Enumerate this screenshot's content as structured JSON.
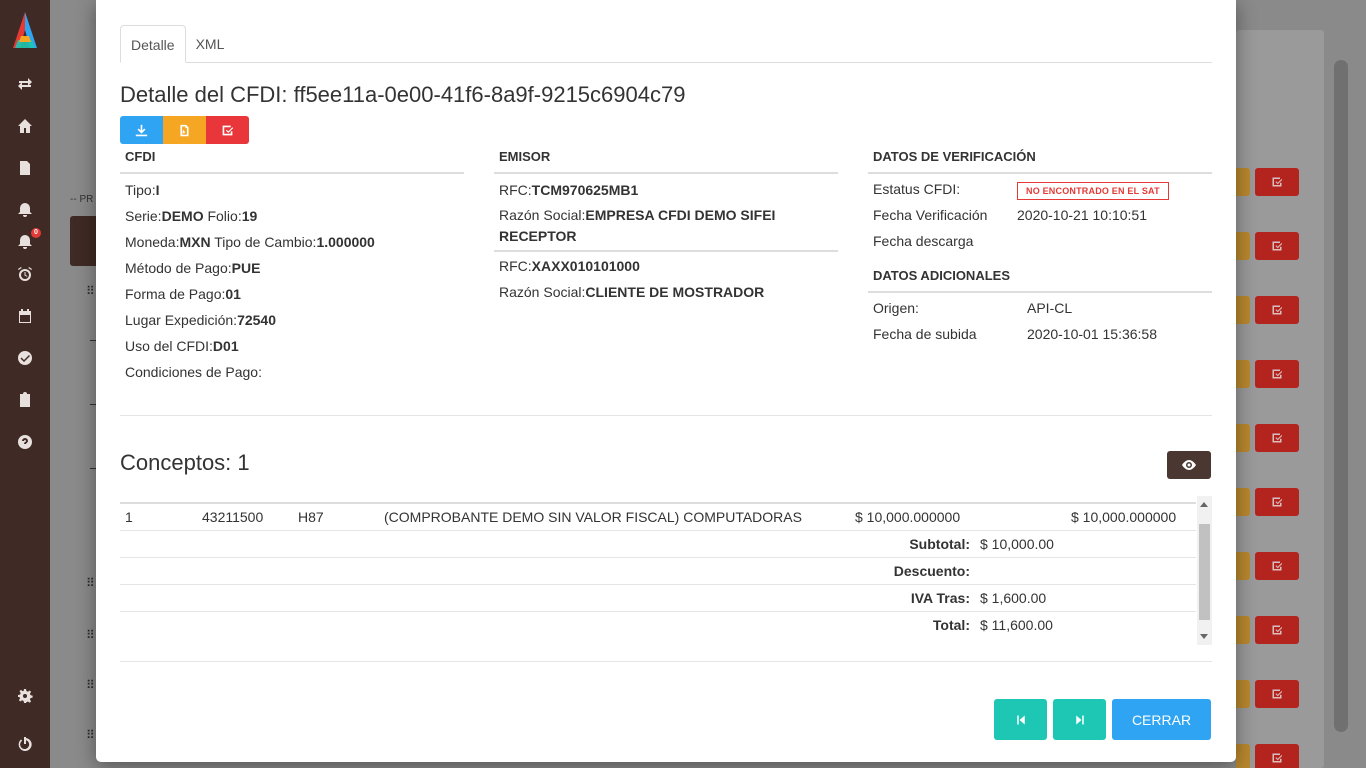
{
  "tabs": [
    {
      "label": "Detalle"
    },
    {
      "label": "XML"
    }
  ],
  "title": "Detalle del CFDI: ff5ee11a-0e00-41f6-8a9f-9215c6904c79",
  "background": {
    "prefix_label": "-- PR"
  },
  "sidebar": {
    "alarm_badge": "0"
  },
  "cfdi": {
    "heading": "CFDI",
    "tipo_label": "Tipo:",
    "tipo": "I",
    "serie_label": "Serie:",
    "serie": "DEMO",
    "folio_label": "Folio:",
    "folio": "19",
    "moneda_label": "Moneda:",
    "moneda": "MXN",
    "tipo_cambio_label": "Tipo de Cambio:",
    "tipo_cambio": "1.000000",
    "metodo_label": "Método de Pago:",
    "metodo": "PUE",
    "forma_label": "Forma de Pago:",
    "forma": "01",
    "lugar_label": "Lugar Expedición:",
    "lugar": "72540",
    "uso_label": "Uso del CFDI:",
    "uso": "D01",
    "condiciones_label": "Condiciones de Pago:"
  },
  "emisor": {
    "heading": "EMISOR",
    "rfc_label": "RFC:",
    "rfc": "TCM970625MB1",
    "razon_label": "Razón Social:",
    "razon": "EMPRESA CFDI DEMO SIFEI",
    "receptor_label": "RECEPTOR",
    "rfc2_label": "RFC:",
    "rfc2": "XAXX010101000",
    "razon2_label": "Razón Social:",
    "razon2": "CLIENTE DE MOSTRADOR"
  },
  "verificacion": {
    "heading": "DATOS DE VERIFICACIÓN",
    "estatus_label": "Estatus CFDI:",
    "estatus": "NO ENCONTRADO EN EL SAT",
    "fecha_ver_label": "Fecha Verificación",
    "fecha_ver": "2020-10-21 10:10:51",
    "fecha_desc_label": "Fecha descarga"
  },
  "adicionales": {
    "heading": "DATOS ADICIONALES",
    "origen_label": "Origen:",
    "origen": "API-CL",
    "subida_label": "Fecha de subida",
    "subida": "2020-10-01 15:36:58"
  },
  "conceptos": {
    "title": "Conceptos: 1",
    "rows": [
      {
        "cantidad": "1",
        "clave": "43211500",
        "unidad": "H87",
        "descripcion": "(COMPROBANTE DEMO SIN VALOR FISCAL) COMPUTADORAS",
        "valor_unitario": "$ 10,000.000000",
        "importe": "$ 10,000.000000"
      }
    ],
    "totals": [
      {
        "label": "Subtotal:",
        "value": "$ 10,000.00"
      },
      {
        "label": "Descuento:",
        "value": ""
      },
      {
        "label": "IVA Tras:",
        "value": "$ 1,600.00"
      },
      {
        "label": "Total:",
        "value": "$ 11,600.00"
      }
    ]
  },
  "footer": {
    "close_label": "CERRAR"
  },
  "colors": {
    "sidebar": "#3f2a25",
    "blue": "#2fa4f2",
    "orange": "#f5a623",
    "red": "#e9363a",
    "teal": "#1ec7b3",
    "dark_brown": "#4a3731"
  }
}
